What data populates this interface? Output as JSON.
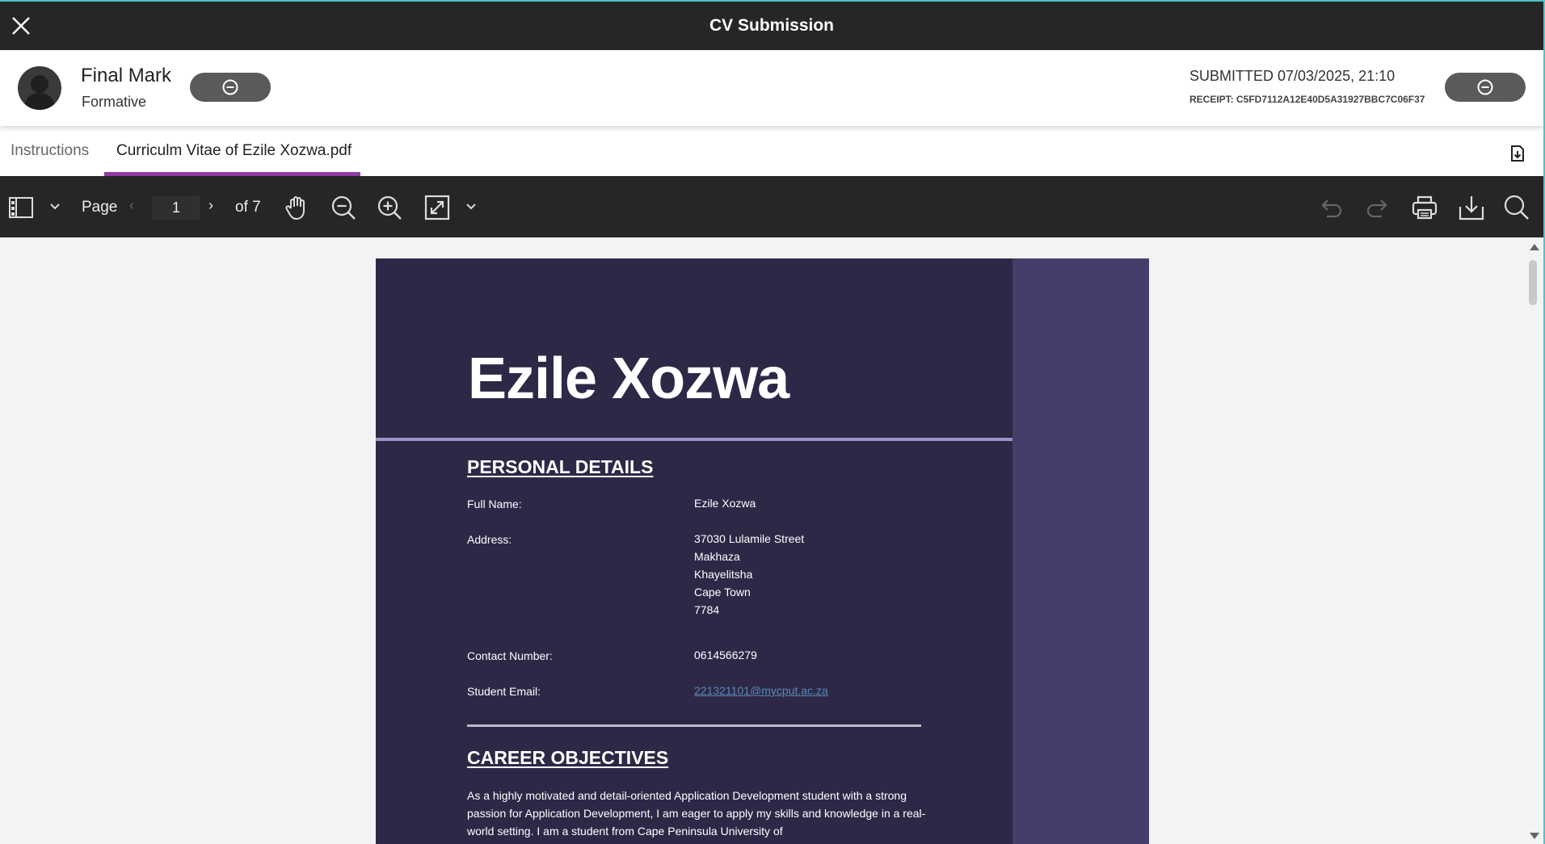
{
  "titlebar": {
    "title": "CV Submission"
  },
  "header": {
    "mark_title": "Final Mark",
    "mark_subtitle": "Formative",
    "submitted": "SUBMITTED 07/03/2025, 21:10",
    "receipt": "RECEIPT: C5FD7112A12E40D5A31927BBC7C06F37"
  },
  "tabs": [
    {
      "label": "Instructions",
      "active": false
    },
    {
      "label": "Curriculm Vitae of Ezile Xozwa.pdf",
      "active": true
    }
  ],
  "toolbar": {
    "page_label": "Page",
    "page_value": "1",
    "page_total": "of 7"
  },
  "document": {
    "name": "Ezile Xozwa",
    "personal_heading": "PERSONAL DETAILS",
    "full_name_label": "Full Name:",
    "full_name_value": "Ezile Xozwa",
    "address_label": "Address:",
    "address_lines": [
      "37030 Lulamile Street",
      "Makhaza",
      "Khayelitsha",
      "Cape Town",
      "7784"
    ],
    "contact_label": "Contact Number:",
    "contact_value": "0614566279",
    "email_label": "Student Email:",
    "email_value": "221321101@mycput.ac.za",
    "career_heading": "CAREER OBJECTIVES",
    "career_text": "As a highly motivated and detail-oriented Application Development student with a strong passion for Application Development, I am eager to apply my skills and knowledge in a real-world setting. I am a student from Cape Peninsula University of"
  },
  "colors": {
    "titlebar": "#262626",
    "accent_tab": "#8e3aa6",
    "pdf_main": "#2d2846",
    "pdf_side": "#473d6b",
    "pdf_rule": "#9a92cc"
  }
}
